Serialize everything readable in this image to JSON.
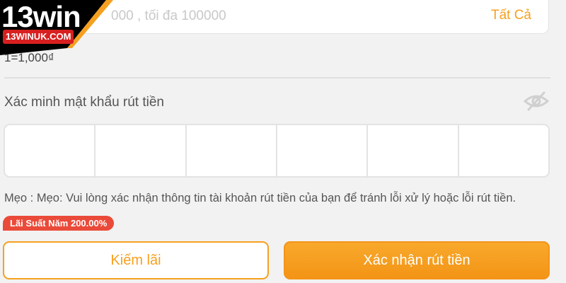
{
  "amount_input": {
    "placeholder": "000 , tối đa 100000",
    "all_label": "Tất Cả"
  },
  "rate": "1=1,000₫",
  "verify": {
    "label": "Xác minh mật khẩu rút tiền",
    "pin": [
      "",
      "",
      "",
      "",
      "",
      ""
    ]
  },
  "tip": "Mẹo : Mẹo: Vui lòng xác nhận thông tin tài khoản rút tiền của bạn để tránh lỗi xử lý hoặc lỗi rút tiền.",
  "interest_badge": "Lãi Suất Năm 200.00%",
  "buttons": {
    "earn": "Kiếm lãi",
    "confirm": "Xác nhận rút tiền"
  },
  "logo": {
    "brand": "13win",
    "url": "13WINUK.COM"
  },
  "icons": {
    "eye": "eye-off-icon"
  },
  "colors": {
    "accent": "#f6a020",
    "badge": "#ea4a39",
    "logo_red": "#d81f1f"
  }
}
